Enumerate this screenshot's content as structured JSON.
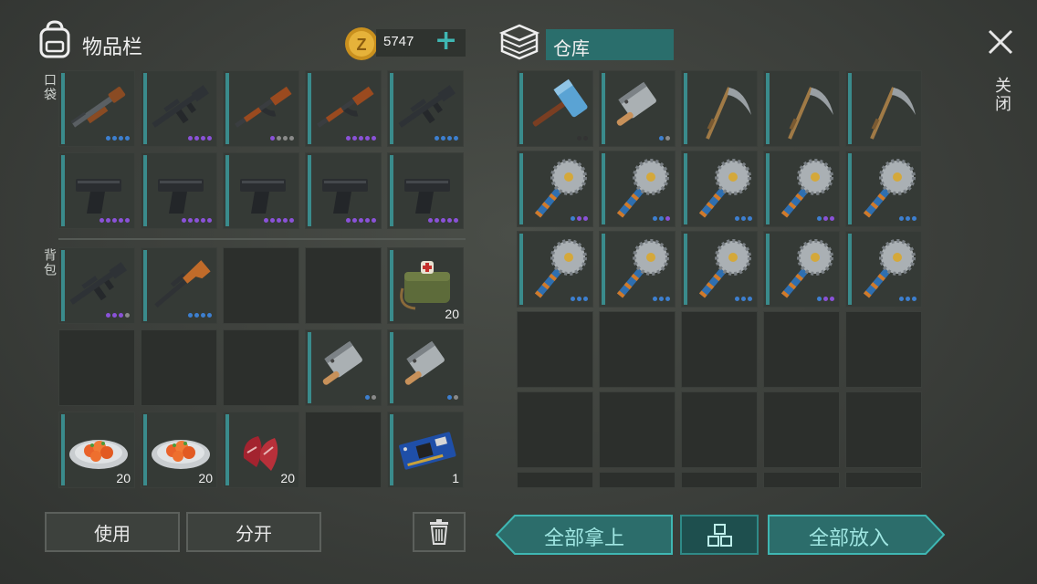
{
  "inventory": {
    "title": "物品栏",
    "coins": "5747",
    "pocket_label": "口袋",
    "backpack_label": "背包"
  },
  "storage": {
    "title": "仓库"
  },
  "close": {
    "label": "关闭"
  },
  "buttons": {
    "use": "使用",
    "split": "分开",
    "take_all": "全部拿上",
    "put_all": "全部放入"
  },
  "pocket_slots": [
    {
      "item": "shotgun",
      "dots": [
        "#3d7fd0",
        "#3d7fd0",
        "#3d7fd0",
        "#3d7fd0"
      ]
    },
    {
      "item": "assault-rifle",
      "dots": [
        "#8a52d8",
        "#8a52d8",
        "#8a52d8",
        "#8a52d8"
      ]
    },
    {
      "item": "ak-rifle",
      "dots": [
        "#8a52d8",
        "#8a8a8a",
        "#8a8a8a",
        "#8a8a8a"
      ]
    },
    {
      "item": "ak-rifle",
      "dots": [
        "#8a52d8",
        "#8a52d8",
        "#8a52d8",
        "#8a52d8",
        "#8a52d8"
      ]
    },
    {
      "item": "assault-rifle",
      "dots": [
        "#3d7fd0",
        "#3d7fd0",
        "#3d7fd0",
        "#3d7fd0"
      ]
    },
    {
      "item": "pistol",
      "dots": [
        "#8a52d8",
        "#8a52d8",
        "#8a52d8",
        "#8a52d8",
        "#8a52d8"
      ]
    },
    {
      "item": "pistol",
      "dots": [
        "#8a52d8",
        "#8a52d8",
        "#8a52d8",
        "#8a52d8",
        "#8a52d8"
      ]
    },
    {
      "item": "pistol",
      "dots": [
        "#8a52d8",
        "#8a52d8",
        "#8a52d8",
        "#8a52d8",
        "#8a52d8"
      ]
    },
    {
      "item": "pistol",
      "dots": [
        "#8a52d8",
        "#8a52d8",
        "#8a52d8",
        "#8a52d8",
        "#8a52d8"
      ]
    },
    {
      "item": "pistol",
      "dots": [
        "#8a52d8",
        "#8a52d8",
        "#8a52d8",
        "#8a52d8",
        "#8a52d8"
      ]
    }
  ],
  "backpack_slots": [
    {
      "item": "assault-rifle",
      "dots": [
        "#8a52d8",
        "#8a52d8",
        "#8a52d8",
        "#8a8a8a"
      ]
    },
    {
      "item": "sniper-rifle",
      "dots": [
        "#3d7fd0",
        "#3d7fd0",
        "#3d7fd0",
        "#3d7fd0"
      ]
    },
    {
      "item": ""
    },
    {
      "item": ""
    },
    {
      "item": "medkit-bag",
      "qty": "20"
    },
    {
      "item": ""
    },
    {
      "item": ""
    },
    {
      "item": ""
    },
    {
      "item": "cleaver",
      "dots": [
        "#3d7fd0",
        "#8a8a8a"
      ]
    },
    {
      "item": "cleaver",
      "dots": [
        "#3d7fd0",
        "#8a8a8a"
      ]
    },
    {
      "item": "food-plate",
      "qty": "20"
    },
    {
      "item": "food-plate",
      "qty": "20"
    },
    {
      "item": "raw-meat",
      "qty": "20"
    },
    {
      "item": ""
    },
    {
      "item": "circuit-board",
      "qty": "1"
    }
  ],
  "storage_slots": [
    {
      "item": "sledgehammer",
      "dots": [
        "#333333",
        "#333333"
      ]
    },
    {
      "item": "cleaver",
      "dots": [
        "#3d7fd0",
        "#8a8a8a"
      ]
    },
    {
      "item": "scythe"
    },
    {
      "item": "scythe"
    },
    {
      "item": "scythe"
    },
    {
      "item": "saw-mace",
      "dots": [
        "#3d7fd0",
        "#8a52d8",
        "#8a52d8"
      ]
    },
    {
      "item": "saw-mace",
      "dots": [
        "#3d7fd0",
        "#3d7fd0",
        "#8a52d8"
      ]
    },
    {
      "item": "saw-mace",
      "dots": [
        "#3d7fd0",
        "#3d7fd0",
        "#3d7fd0"
      ]
    },
    {
      "item": "saw-mace",
      "dots": [
        "#3d7fd0",
        "#8a52d8",
        "#8a52d8"
      ]
    },
    {
      "item": "saw-mace",
      "dots": [
        "#3d7fd0",
        "#3d7fd0",
        "#3d7fd0"
      ]
    },
    {
      "item": "saw-mace",
      "dots": [
        "#3d7fd0",
        "#3d7fd0",
        "#3d7fd0"
      ]
    },
    {
      "item": "saw-mace",
      "dots": [
        "#3d7fd0",
        "#3d7fd0",
        "#3d7fd0"
      ]
    },
    {
      "item": "saw-mace",
      "dots": [
        "#3d7fd0",
        "#3d7fd0",
        "#3d7fd0"
      ]
    },
    {
      "item": "saw-mace",
      "dots": [
        "#3d7fd0",
        "#8a52d8",
        "#8a52d8"
      ]
    },
    {
      "item": "saw-mace",
      "dots": [
        "#3d7fd0",
        "#3d7fd0",
        "#3d7fd0"
      ]
    },
    {
      "item": ""
    },
    {
      "item": ""
    },
    {
      "item": ""
    },
    {
      "item": ""
    },
    {
      "item": ""
    },
    {
      "item": ""
    },
    {
      "item": ""
    },
    {
      "item": ""
    },
    {
      "item": ""
    },
    {
      "item": ""
    },
    {
      "item": ""
    },
    {
      "item": ""
    },
    {
      "item": ""
    },
    {
      "item": ""
    },
    {
      "item": ""
    }
  ],
  "colors": {
    "accent": "#3fb7b3",
    "accent_dark": "#1f5d5c",
    "rarity_blue": "#3d7fd0",
    "rarity_purple": "#8a52d8"
  }
}
